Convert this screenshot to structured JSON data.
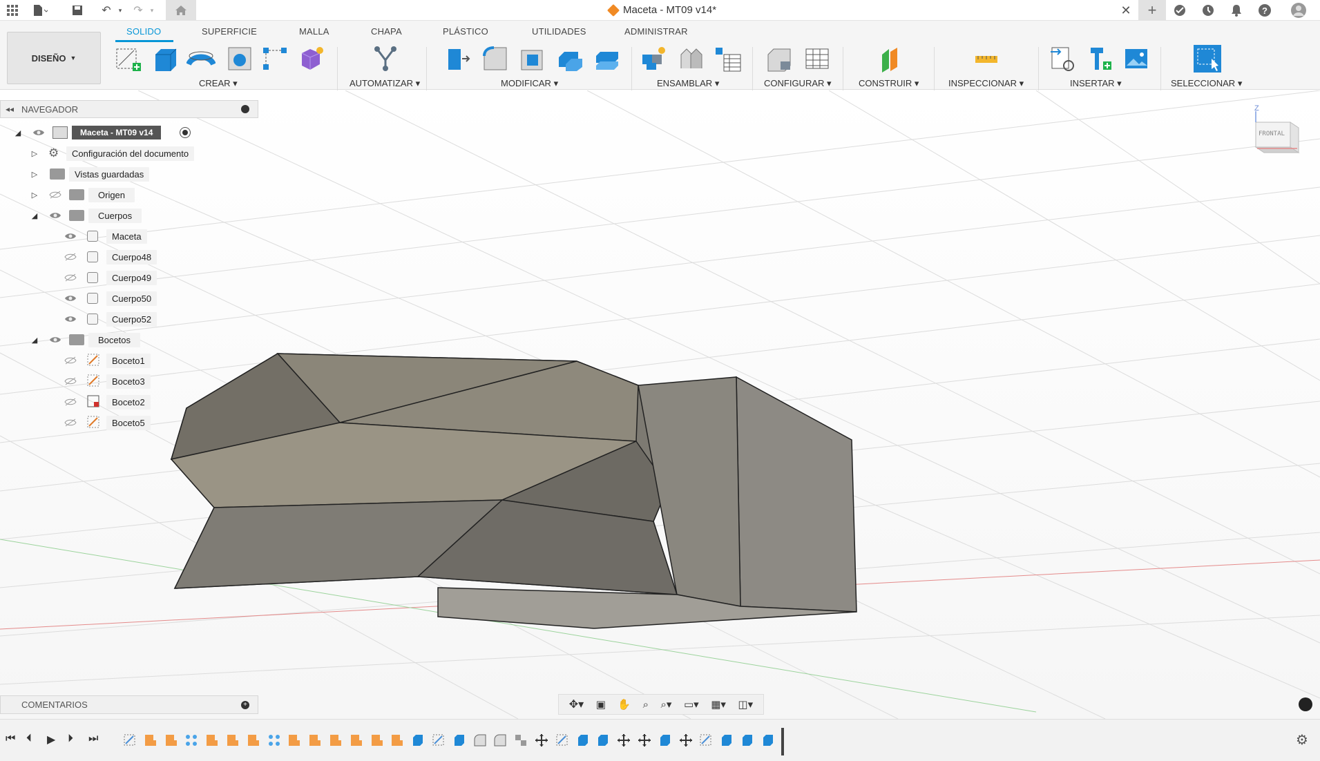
{
  "window": {
    "title": "Maceta - MT09 v14*"
  },
  "workspace": {
    "label": "DISEÑO"
  },
  "tabs": [
    "SOLIDO",
    "SUPERFICIE",
    "MALLA",
    "CHAPA",
    "PLÁSTICO",
    "UTILIDADES",
    "ADMINISTRAR"
  ],
  "groups": [
    "CREAR",
    "AUTOMATIZAR",
    "MODIFICAR",
    "ENSAMBLAR",
    "CONFIGURAR",
    "CONSTRUIR",
    "INSPECCIONAR",
    "INSERTAR",
    "SELECCIONAR"
  ],
  "navigator": {
    "title": "NAVEGADOR",
    "root": "Maceta - MT09 v14",
    "items": [
      {
        "label": "Configuración del documento"
      },
      {
        "label": "Vistas guardadas"
      },
      {
        "label": "Origen"
      },
      {
        "label": "Cuerpos"
      },
      {
        "label": "Maceta"
      },
      {
        "label": "Cuerpo48"
      },
      {
        "label": "Cuerpo49"
      },
      {
        "label": "Cuerpo50"
      },
      {
        "label": "Cuerpo52"
      },
      {
        "label": "Bocetos"
      },
      {
        "label": "Boceto1"
      },
      {
        "label": "Boceto3"
      },
      {
        "label": "Boceto2"
      },
      {
        "label": "Boceto5"
      }
    ]
  },
  "viewcube": {
    "face": "FRONTAL",
    "axis": "Z"
  },
  "comments": {
    "title": "COMENTARIOS"
  },
  "colors": {
    "accent": "#0696d7",
    "body": "#8a877f",
    "timeline_feature": "#f39c45"
  }
}
